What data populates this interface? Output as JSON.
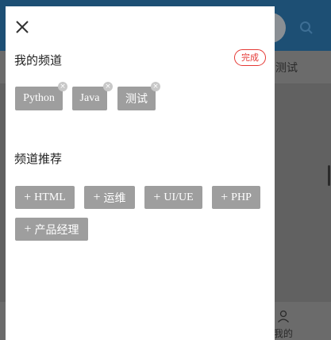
{
  "background": {
    "tab_label": "测试",
    "footer_label": "我的"
  },
  "drawer": {
    "my_channels_title": "我的频道",
    "done_label": "完成",
    "my_channels": [
      {
        "label": "Python"
      },
      {
        "label": "Java"
      },
      {
        "label": "测试"
      }
    ],
    "recommend_title": "频道推荐",
    "recommended": [
      {
        "label": "HTML"
      },
      {
        "label": "运维"
      },
      {
        "label": "UI/UE"
      },
      {
        "label": "PHP"
      },
      {
        "label": "产品经理"
      }
    ],
    "add_symbol": "+",
    "remove_symbol": "×"
  },
  "colors": {
    "accent_red": "#e53935",
    "chip_bg": "#9e9e9e",
    "header_bg": "#1d4f74"
  }
}
